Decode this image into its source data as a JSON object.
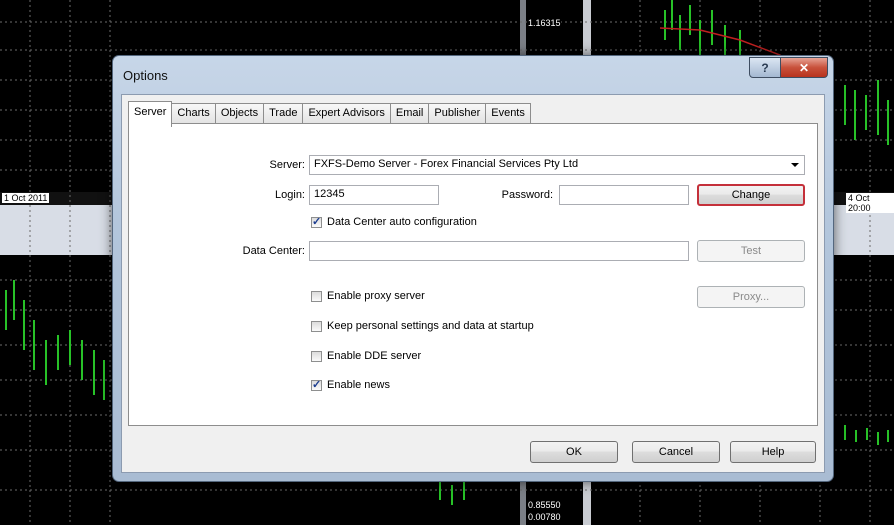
{
  "background": {
    "price_top": "1.16315",
    "price_bottom": "0.85550",
    "price_bottom_2": "0.00780",
    "date_left": "1 Oct 2011",
    "date_right": "4 Oct 20:00"
  },
  "dialog": {
    "title": "Options",
    "help_button": "?",
    "close_button": "✕",
    "tabs": [
      {
        "label": "Server",
        "active": true
      },
      {
        "label": "Charts"
      },
      {
        "label": "Objects"
      },
      {
        "label": "Trade"
      },
      {
        "label": "Expert Advisors"
      },
      {
        "label": "Email"
      },
      {
        "label": "Publisher"
      },
      {
        "label": "Events"
      }
    ],
    "server": {
      "server_label": "Server:",
      "server_value": "FXFS-Demo Server - Forex Financial Services Pty Ltd",
      "login_label": "Login:",
      "login_value": "12345",
      "password_label": "Password:",
      "password_value": "",
      "change_button": "Change",
      "datacenter_auto_label": "Data Center auto configuration",
      "datacenter_label": "Data Center:",
      "datacenter_value": "",
      "test_button": "Test",
      "proxy_label": "Enable proxy server",
      "proxy_button": "Proxy...",
      "keep_settings_label": "Keep personal settings and data at startup",
      "dde_label": "Enable DDE server",
      "news_label": "Enable news",
      "checks": {
        "datacenter_auto": true,
        "proxy": false,
        "keep_settings": false,
        "dde": false,
        "news": true
      }
    },
    "footer": {
      "ok_button": "OK",
      "cancel_button": "Cancel",
      "help_button": "Help"
    }
  }
}
